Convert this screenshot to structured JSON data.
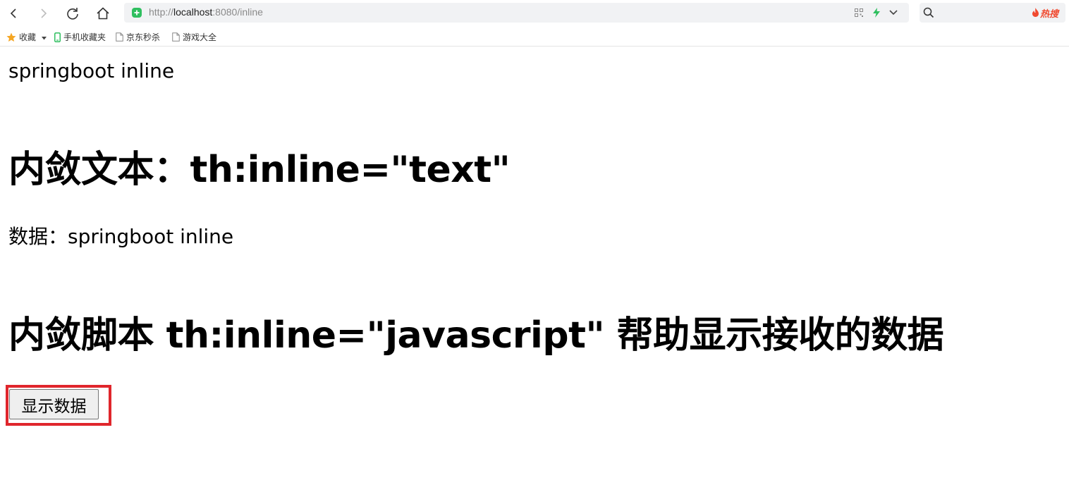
{
  "browser": {
    "url_scheme": "http://",
    "url_host": "localhost",
    "url_rest": ":8080/inline",
    "hot_search_label": "热搜",
    "accent_green": "#2fbf5f",
    "hot_color": "#f0492f"
  },
  "bookmarks": {
    "items": [
      {
        "label": "收藏",
        "icon": "star-icon"
      },
      {
        "label": "手机收藏夹",
        "icon": "phone-icon"
      },
      {
        "label": "京东秒杀",
        "icon": "page-icon"
      },
      {
        "label": "游戏大全",
        "icon": "page-icon"
      }
    ]
  },
  "page": {
    "line1": "springboot inline",
    "heading1": "内敛文本：th:inline=\"text\"",
    "line2": "数据：springboot inline",
    "heading2": "内敛脚本 th:inline=\"javascript\" 帮助显示接收的数据",
    "button_label": "显示数据",
    "highlight_color": "#e0262c"
  }
}
